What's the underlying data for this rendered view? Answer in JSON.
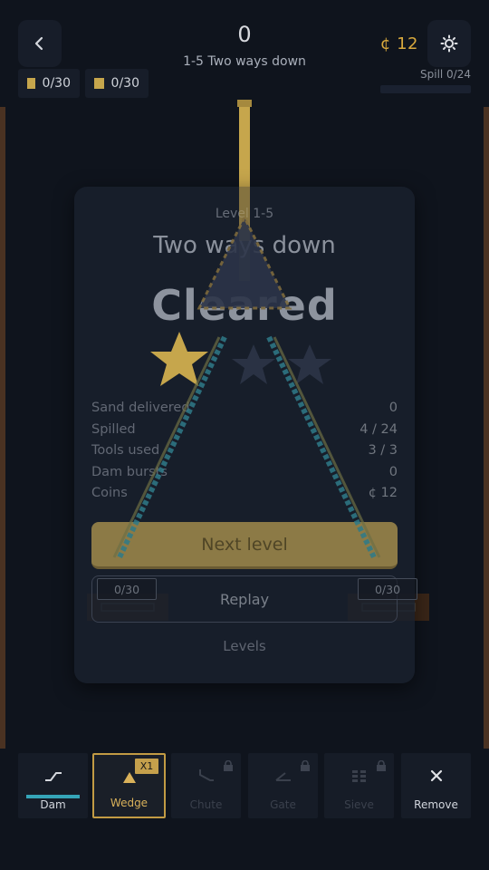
{
  "header": {
    "score": "0",
    "level_subtitle": "1-5  Two ways down",
    "coins": "¢ 12",
    "spill_label": "Spill 0/24",
    "spill_fraction": 0,
    "counters": [
      {
        "value": "0/30",
        "color": "#c6a64c"
      },
      {
        "value": "0/30",
        "color": "#c6a64c"
      }
    ],
    "back_icon": "chevron-left-icon",
    "settings_icon": "sun-gear-icon"
  },
  "modal": {
    "level_label": "Level 1-5",
    "title": "Two ways down",
    "status": "Cleared",
    "stars_earned": 1,
    "stars_total": 3,
    "stats": [
      {
        "label": "Sand delivered",
        "value": "0"
      },
      {
        "label": "Spilled",
        "value": "4 / 24"
      },
      {
        "label": "Tools used",
        "value": "3 / 3"
      },
      {
        "label": "Dam bursts",
        "value": "0"
      },
      {
        "label": "Coins",
        "value": "¢ 12"
      }
    ],
    "next_label": "Next level",
    "replay_label": "Replay",
    "levels_label": "Levels"
  },
  "bins": [
    {
      "count": "0/30"
    },
    {
      "count": "0/30"
    }
  ],
  "toolbar": {
    "tools": [
      {
        "label": "Dam",
        "icon": "dam-icon",
        "locked": false
      },
      {
        "label": "Wedge",
        "icon": "wedge-icon",
        "locked": false,
        "badge": "X1",
        "selected": true
      },
      {
        "label": "Chute",
        "icon": "chute-icon",
        "locked": true
      },
      {
        "label": "Gate",
        "icon": "gate-icon",
        "locked": true
      },
      {
        "label": "Sieve",
        "icon": "sieve-icon",
        "locked": true
      },
      {
        "label": "Remove",
        "icon": "close-icon",
        "locked": false
      }
    ]
  },
  "colors": {
    "sand": "#c6a64c",
    "accent_gold": "#d8a93d",
    "water_blue": "#35a5b8",
    "wall_brown": "#4a3222",
    "background": "#0f141d"
  }
}
